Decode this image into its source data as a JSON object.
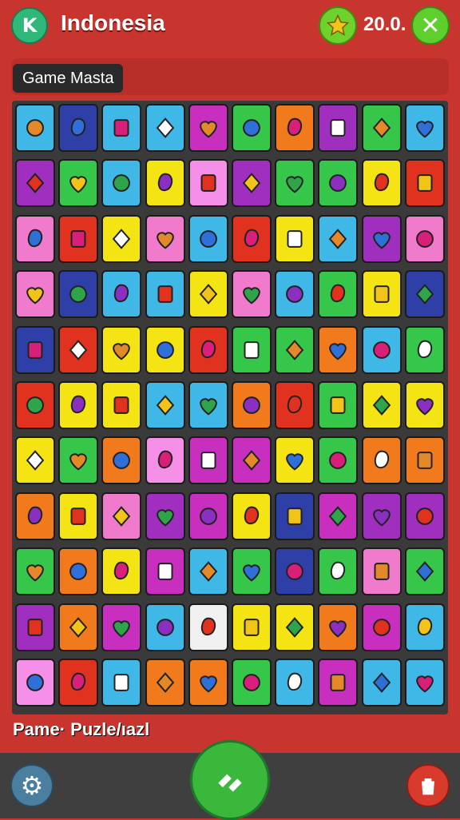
{
  "header": {
    "logo_glyph": "K",
    "title": "Indonesia",
    "score": "20.0.",
    "close_glyph": "✕"
  },
  "subheader": {
    "label": "Game Masta"
  },
  "footer": {
    "label": "Pame· Puzle/ıazl"
  },
  "grid": {
    "rows": 11,
    "cols": 10,
    "tiles": [
      [
        "#3fb8e8",
        "#2f3fa8",
        "#3fb8e8",
        "#3fb8e8",
        "#c92fbf",
        "#35c64a",
        "#f07a1c",
        "#a02fbf",
        "#35c64a",
        "#3fb8e8"
      ],
      [
        "#a02fbf",
        "#35c64a",
        "#3fb8e8",
        "#f5e414",
        "#f58fe8",
        "#a02fbf",
        "#35c64a",
        "#35c64a",
        "#f5e414",
        "#e0321e"
      ],
      [
        "#f07acc",
        "#e0321e",
        "#f5e414",
        "#f07acc",
        "#3fb8e8",
        "#e0321e",
        "#f5e414",
        "#3fb8e8",
        "#a02fbf",
        "#f07acc"
      ],
      [
        "#f07acc",
        "#2f3fa8",
        "#3fb8e8",
        "#3fb8e8",
        "#f5e414",
        "#f07acc",
        "#3fb8e8",
        "#35c64a",
        "#f5e414",
        "#2f3fa8"
      ],
      [
        "#2f3fa8",
        "#e0321e",
        "#f5e414",
        "#f5e414",
        "#e0321e",
        "#35c64a",
        "#35c64a",
        "#f07a1c",
        "#3fb8e8",
        "#35c64a"
      ],
      [
        "#e0321e",
        "#f5e414",
        "#f5e414",
        "#3fb8e8",
        "#3fb8e8",
        "#f07a1c",
        "#e0321e",
        "#35c64a",
        "#f5e414",
        "#f5e414"
      ],
      [
        "#f5e414",
        "#35c64a",
        "#f07a1c",
        "#f58fe8",
        "#c92fbf",
        "#c92fbf",
        "#f5e414",
        "#35c64a",
        "#f07a1c",
        "#f07a1c"
      ],
      [
        "#f07a1c",
        "#f5e414",
        "#f07acc",
        "#a02fbf",
        "#c92fbf",
        "#f5e414",
        "#2f3fa8",
        "#c92fbf",
        "#a02fbf",
        "#a02fbf"
      ],
      [
        "#35c64a",
        "#f07a1c",
        "#f5e414",
        "#c92fbf",
        "#3fb8e8",
        "#35c64a",
        "#2f3fa8",
        "#35c64a",
        "#f07acc",
        "#35c64a"
      ],
      [
        "#a02fbf",
        "#f07a1c",
        "#c92fbf",
        "#3fb8e8",
        "#f0f0f0",
        "#f5e414",
        "#f5e414",
        "#f07a1c",
        "#c92fbf",
        "#3fb8e8"
      ],
      [
        "#f58fe8",
        "#e0321e",
        "#3fb8e8",
        "#f07a1c",
        "#f07a1c",
        "#35c64a",
        "#3fb8e8",
        "#c92fbf",
        "#3fb8e8",
        "#3fb8e8"
      ]
    ],
    "icons": [
      [
        "croissant-icon",
        "chili-icon",
        "cheese-icon",
        "pear-icon",
        "onion-icon",
        "tomato-icon",
        "lemon-icon",
        "jar-icon",
        "carrot-icon",
        "cake-icon"
      ],
      [
        "flower-icon",
        "eggplant-icon",
        "balloon-icon",
        "pen-icon",
        "apple-icon",
        "pin-icon",
        "leaf-icon",
        "bottle-icon",
        "leaf-icon",
        "bottle-icon"
      ],
      [
        "ball-icon",
        "leaf-icon",
        "tomato-icon",
        "tomato-icon",
        "mushroom-icon",
        "onion-icon",
        "cloud-icon",
        "berry-icon",
        "bush-icon",
        "broom-icon"
      ],
      [
        "log-icon",
        "radish-icon",
        "tree-icon",
        "bubble-icon",
        "onion-icon",
        "box-icon",
        "box-icon",
        "jar-icon",
        "bottle-icon",
        "plum-icon"
      ],
      [
        "cinnamon-icon",
        "berry-icon",
        "jar-icon",
        "jar-icon",
        "waves-icon",
        "gourd-icon",
        "drop-icon",
        "heart-icon",
        "knot-icon",
        "pepper-icon"
      ],
      [
        "jar-icon",
        "pen-icon",
        "lock-icon",
        "bird-icon",
        "leaf-icon",
        "card-icon",
        "gate-icon",
        "gem-icon",
        "drop-icon",
        "screen-icon"
      ],
      [
        "flower-icon",
        "cross-icon",
        "egg-icon",
        "onion-icon",
        "spiral-icon",
        "berry-icon",
        "box-icon",
        "leaf-icon",
        "leaf-icon",
        "egg-icon"
      ],
      [
        "pear-icon",
        "stack-icon",
        "flower-icon",
        "apple-icon",
        "apple-icon",
        "heart-icon",
        "sprout-icon",
        "moon-icon",
        "cheese-icon",
        "pepper-icon"
      ],
      [
        "stick-icon",
        "dragon-icon",
        "shell-icon",
        "cheese-icon",
        "wrench-icon",
        "apple-icon",
        "gourd-icon",
        "onion-icon",
        "box-icon",
        "box-icon"
      ],
      [
        "melon-icon",
        "note-icon",
        "gem-icon",
        "heart-icon",
        "cube-icon",
        "bowl-icon",
        "bird-icon",
        "lollipop-icon",
        "strawberry-icon",
        "lime-icon"
      ],
      [
        "pear-icon",
        "pepper-icon",
        "bowl-icon",
        "bottle-icon",
        "robot-icon",
        "bottle-icon",
        "onion-icon",
        "tree-icon",
        "moon-icon",
        "lime-icon"
      ]
    ]
  },
  "colors": {
    "background": "#c8342e",
    "board": "#3a3a3a"
  }
}
